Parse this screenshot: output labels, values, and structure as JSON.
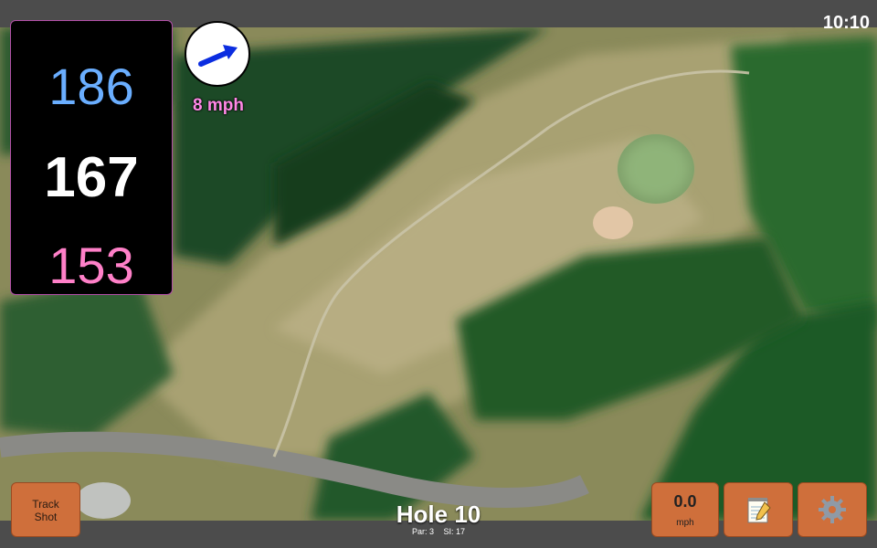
{
  "status": {
    "time": "10:10"
  },
  "distances": {
    "back": "186",
    "middle": "167",
    "front": "153"
  },
  "wind": {
    "speed": "8 mph",
    "direction_icon": "wind-arrow-icon",
    "arrow_color": "#0b2de0"
  },
  "hole": {
    "title": "Hole 10",
    "par": "Par: 3",
    "stroke_index": "SI: 17"
  },
  "buttons": {
    "track_shot": "Track\nShot",
    "speed_value": "0.0",
    "speed_unit": "mph",
    "notes_icon": "notepad-icon",
    "settings_icon": "gear-icon"
  },
  "colors": {
    "back_distance": "#6aaeff",
    "middle_distance": "#ffffff",
    "front_distance": "#ff80c8",
    "button": "#cf6f3b",
    "bar": "#4c4c4c"
  }
}
